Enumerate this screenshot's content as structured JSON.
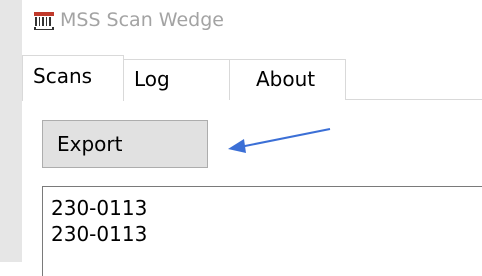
{
  "window": {
    "title": "MSS Scan Wedge",
    "icon": "barcode-scanner-icon"
  },
  "tabs": [
    {
      "label": "Scans",
      "selected": true
    },
    {
      "label": "Log",
      "selected": false
    },
    {
      "label": "About",
      "selected": false
    }
  ],
  "toolbar": {
    "export_label": "Export"
  },
  "annotation": {
    "icon": "arrow-left-icon",
    "color": "#3b6fd6"
  },
  "scans": [
    "230-0113",
    "230-0113"
  ]
}
